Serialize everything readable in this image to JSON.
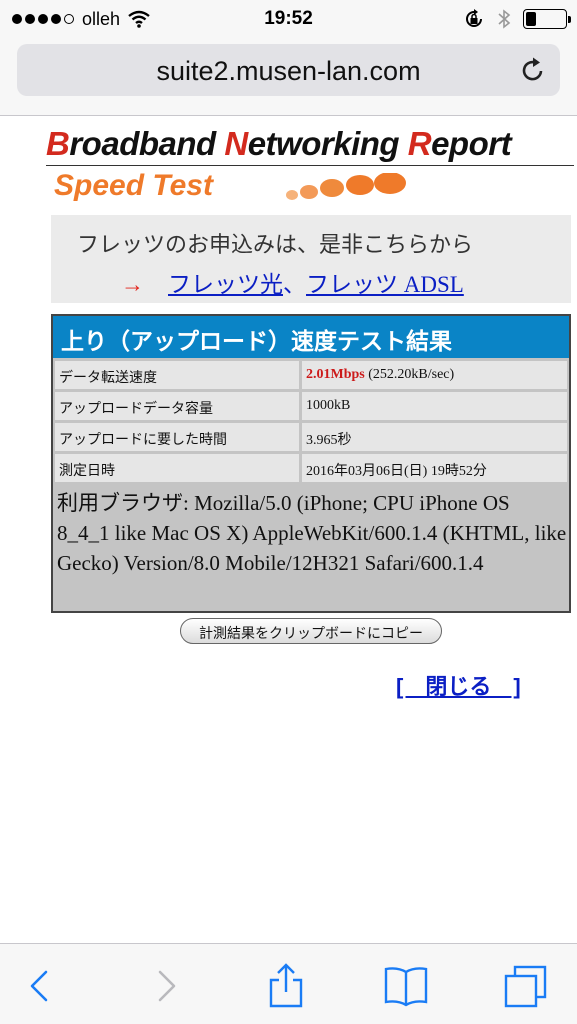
{
  "status_bar": {
    "carrier": "olleh",
    "time": "19:52",
    "signal_dots_filled": 4,
    "signal_dots_total": 5,
    "battery_level": 0.25
  },
  "url_bar": {
    "url": "suite2.musen-lan.com"
  },
  "logo": {
    "title_parts": [
      "B",
      "roadband ",
      "N",
      "etworking ",
      "R",
      "eport"
    ],
    "subtitle": "Speed Test"
  },
  "promo": {
    "text": "フレッツのお申込みは、是非こちらから",
    "arrow": "→",
    "link1": "フレッツ光",
    "separator": "、",
    "link2": "フレッツ ADSL"
  },
  "result": {
    "header": "上り（アップロード）速度テスト結果",
    "rows": [
      {
        "label": "データ転送速度",
        "value_strong": "2.01Mbps",
        "value_rest": " (252.20kB/sec)"
      },
      {
        "label": "アップロードデータ容量",
        "value": "1000kB"
      },
      {
        "label": "アップロードに要した時間",
        "value": "3.965秒"
      },
      {
        "label": "測定日時",
        "value": "2016年03月06日(日) 19時52分"
      }
    ],
    "browser_label": "利用ブラウザ:",
    "browser_value": " Mozilla/5.0 (iPhone; CPU iPhone OS 8_4_1 like Mac OS X) AppleWebKit/600.1.4 (KHTML, like Gecko) Version/8.0 Mobile/12H321 Safari/600.1.4"
  },
  "copy_button": "計測結果をクリップボードにコピー",
  "close_link": "[　閉じる　]",
  "toolbar": {
    "icons": [
      "back-icon",
      "forward-icon",
      "share-icon",
      "bookmarks-icon",
      "tabs-icon"
    ]
  },
  "colors": {
    "header_blue": "#0a84c6",
    "link_blue": "#0b1fc4",
    "speed_red": "#cc1a1a",
    "logo_red": "#d32a1e",
    "logo_orange": "#ef7a2a",
    "ios_blue": "#1a7cf5"
  }
}
